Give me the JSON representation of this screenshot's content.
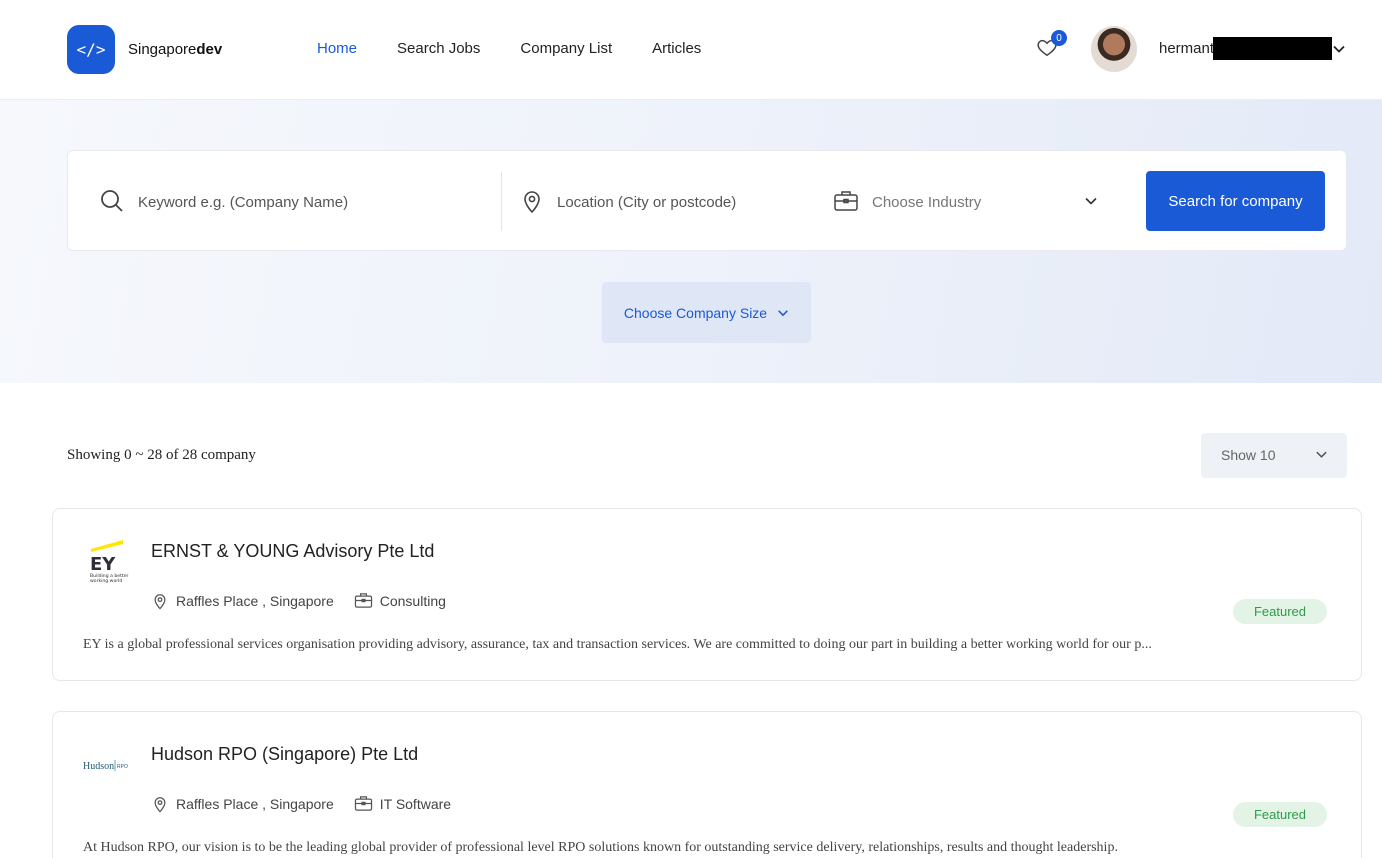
{
  "brand": {
    "mark": "</>",
    "name_regular": "Singapore",
    "name_bold": "dev"
  },
  "nav": [
    {
      "label": "Home",
      "active": true
    },
    {
      "label": "Search Jobs",
      "active": false
    },
    {
      "label": "Company List",
      "active": false
    },
    {
      "label": "Articles",
      "active": false
    }
  ],
  "header": {
    "favorites_count": "0",
    "username": "hermant"
  },
  "search": {
    "keyword_placeholder": "Keyword e.g. (Company Name)",
    "location_placeholder": "Location (City or postcode)",
    "industry_placeholder": "Choose Industry",
    "button_label": "Search for company",
    "company_size_label": "Choose Company Size"
  },
  "results": {
    "summary": "Showing 0 ~ 28 of 28 company",
    "page_size_label": "Show 10"
  },
  "companies": [
    {
      "name": "ERNST & YOUNG Advisory Pte Ltd",
      "location": "Raffles Place , Singapore",
      "industry": "Consulting",
      "badge": "Featured",
      "description": "EY is a global professional services organisation providing advisory, assurance, tax and transaction services. We are committed to doing our part in building a better working world for our p...",
      "logo": {
        "mark": "EY",
        "tagline_1": "Building a better",
        "tagline_2": "working world"
      }
    },
    {
      "name": "Hudson RPO (Singapore) Pte Ltd",
      "location": "Raffles Place , Singapore",
      "industry": "IT Software",
      "badge": "Featured",
      "description": "At Hudson RPO, our vision is to be the leading global provider of professional level RPO solutions known for outstanding service delivery, relationships, results and thought leadership.",
      "logo": {
        "mark": "Hudson",
        "tagline_1": "RPO"
      }
    }
  ],
  "colors": {
    "primary": "#1a5ad6",
    "featured_bg": "#e3f4e6",
    "featured_text": "#2e9b4a",
    "hero_bg": "#eef2fa"
  },
  "icons": [
    "search-icon",
    "location-pin-icon",
    "briefcase-icon",
    "chevron-down-icon",
    "heart-icon"
  ]
}
